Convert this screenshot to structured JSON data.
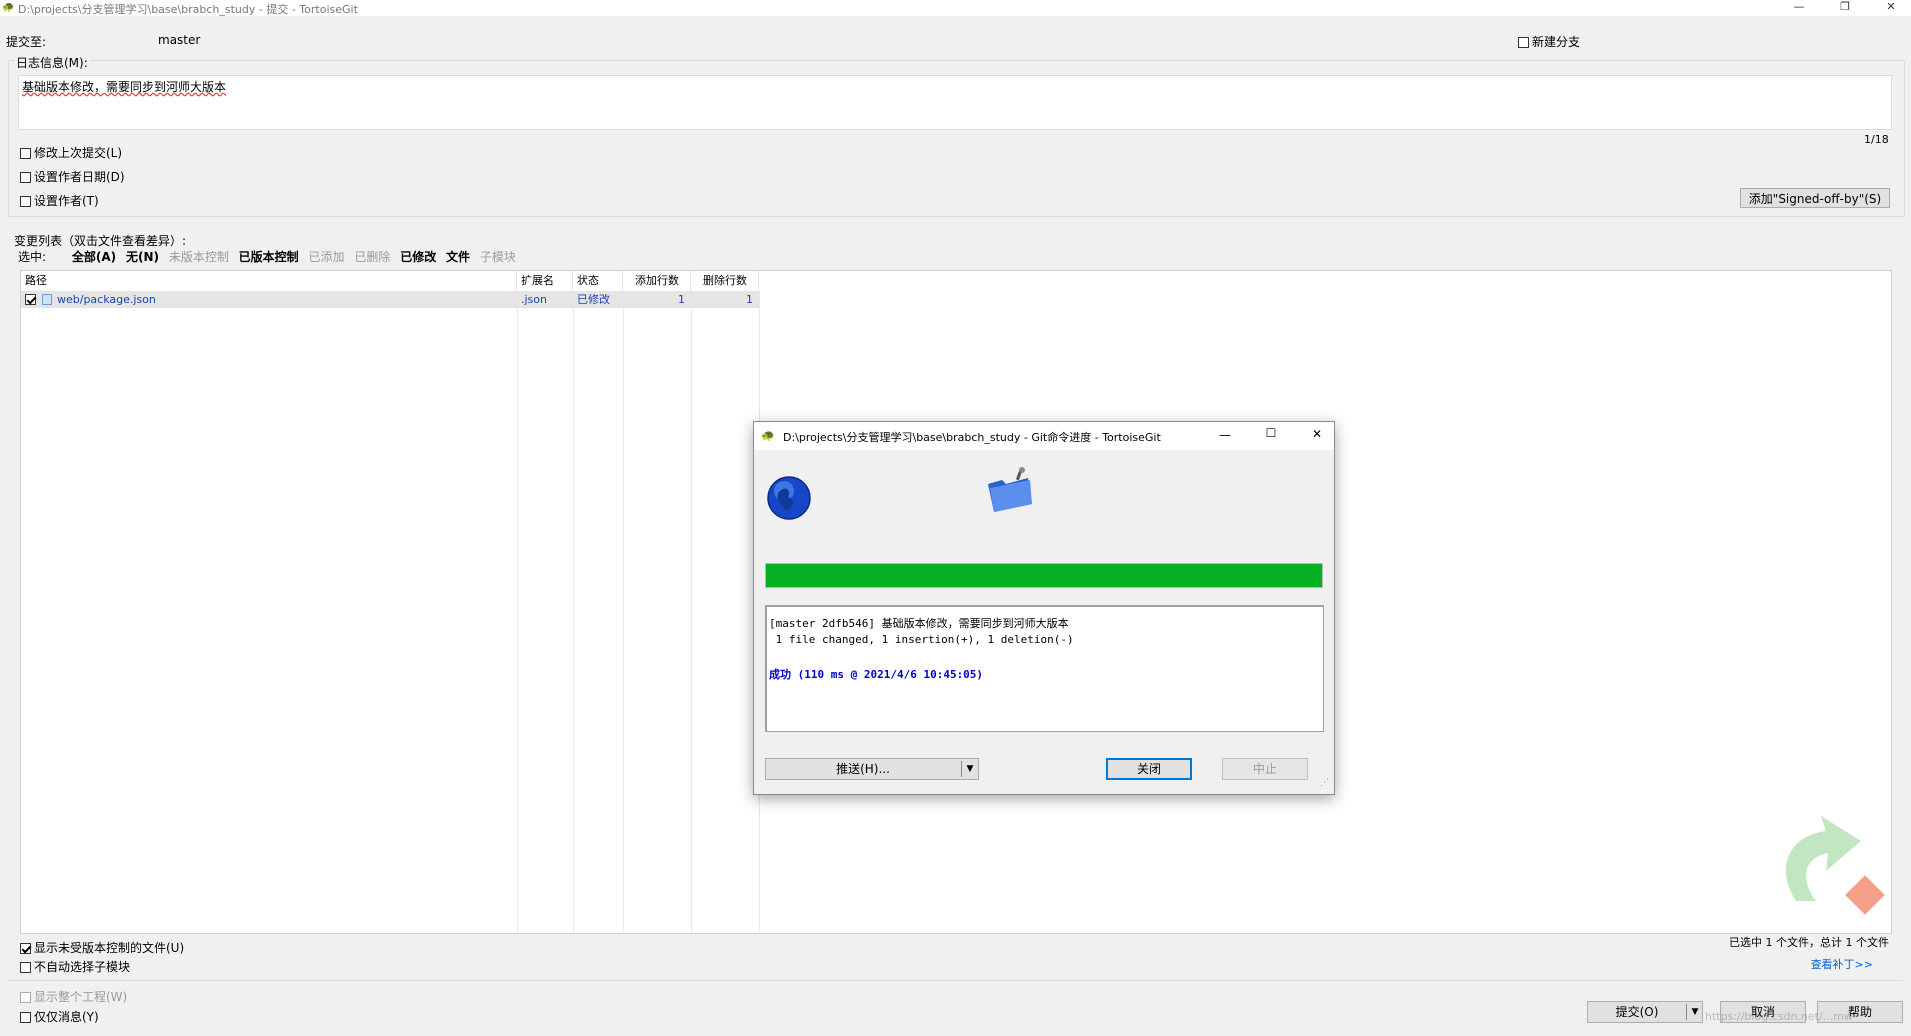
{
  "window": {
    "title": "D:\\projects\\分支管理学习\\base\\brabch_study - 提交 - TortoiseGit"
  },
  "commit_to": {
    "label": "提交至:",
    "branch": "master"
  },
  "new_branch": {
    "label": "新建分支",
    "checked": false
  },
  "log_message": {
    "label": "日志信息(M):",
    "text": "基础版本修改，需要同步到河师大版本",
    "counter": "1/18"
  },
  "options": [
    {
      "label": "修改上次提交(L)",
      "checked": false
    },
    {
      "label": "设置作者日期(D)",
      "checked": false
    },
    {
      "label": "设置作者(T)",
      "checked": false
    }
  ],
  "signed_off_button": "添加\"Signed-off-by\"(S)",
  "changes": {
    "label": "变更列表（双击文件查看差异）:",
    "select_label": "选中:",
    "filters": [
      {
        "label": "全部(A)",
        "style": "bold"
      },
      {
        "label": "无(N)",
        "style": "bold"
      },
      {
        "label": "未版本控制",
        "style": "dim"
      },
      {
        "label": "已版本控制",
        "style": "bold"
      },
      {
        "label": "已添加",
        "style": "dim"
      },
      {
        "label": "已删除",
        "style": "dim"
      },
      {
        "label": "已修改",
        "style": "bold"
      },
      {
        "label": "文件",
        "style": "bold"
      },
      {
        "label": "子模块",
        "style": "dim"
      }
    ],
    "columns": [
      "路径",
      "扩展名",
      "状态",
      "添加行数",
      "删除行数"
    ],
    "rows": [
      {
        "checked": true,
        "path": "web/package.json",
        "ext": ".json",
        "status": "已修改",
        "added": "1",
        "deleted": "1"
      }
    ]
  },
  "bottom_options": [
    {
      "label": "显示未受版本控制的文件(U)",
      "checked": true,
      "disabled": false
    },
    {
      "label": "不自动选择子模块",
      "checked": false,
      "disabled": false
    },
    {
      "label": "显示整个工程(W)",
      "checked": false,
      "disabled": true
    },
    {
      "label": "仅仅消息(Y)",
      "checked": false,
      "disabled": false
    }
  ],
  "selection_status": "已选中 1 个文件，总计 1 个文件",
  "view_patch_link": "查看补丁>>",
  "buttons": {
    "commit": "提交(O)",
    "cancel": "取消",
    "help": "帮助"
  },
  "watermark": "https://blog.csdn.net/...mw",
  "progress_dialog": {
    "title": "D:\\projects\\分支管理学习\\base\\brabch_study - Git命令进度 - TortoiseGit",
    "progress": 1.0,
    "output_lines": [
      "[master 2dfb546] 基础版本修改，需要同步到河师大版本",
      " 1 file changed, 1 insertion(+), 1 deletion(-)"
    ],
    "success_line": "成功 (110 ms @ 2021/4/6 10:45:05)",
    "buttons": {
      "push": "推送(H)...",
      "close": "关闭",
      "abort": "中止"
    }
  },
  "colors": {
    "progress": "#06b025",
    "link": "#0066cc",
    "success": "#0000cc"
  }
}
